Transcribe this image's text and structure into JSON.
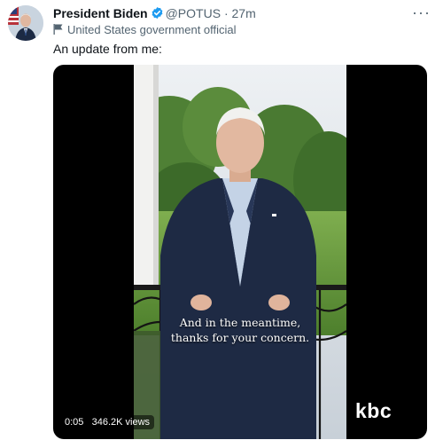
{
  "tweet": {
    "author_name": "President Biden",
    "handle": "@POTUS",
    "separator": "·",
    "time": "27m",
    "label": "United States government official",
    "text": "An update from me:",
    "more_icon": "more-horizontal-icon",
    "verified_icon": "verified-badge-icon",
    "flag_icon": "government-flag-icon"
  },
  "video": {
    "caption_line1": "And in the meantime,",
    "caption_line2": "thanks for your concern.",
    "watermark": "kbc",
    "timestamp": "0:05",
    "views": "346.2K views"
  },
  "colors": {
    "text": "#0f1419",
    "secondary": "#536471",
    "verified": "#1d9bf0",
    "media_bg": "#000000"
  }
}
